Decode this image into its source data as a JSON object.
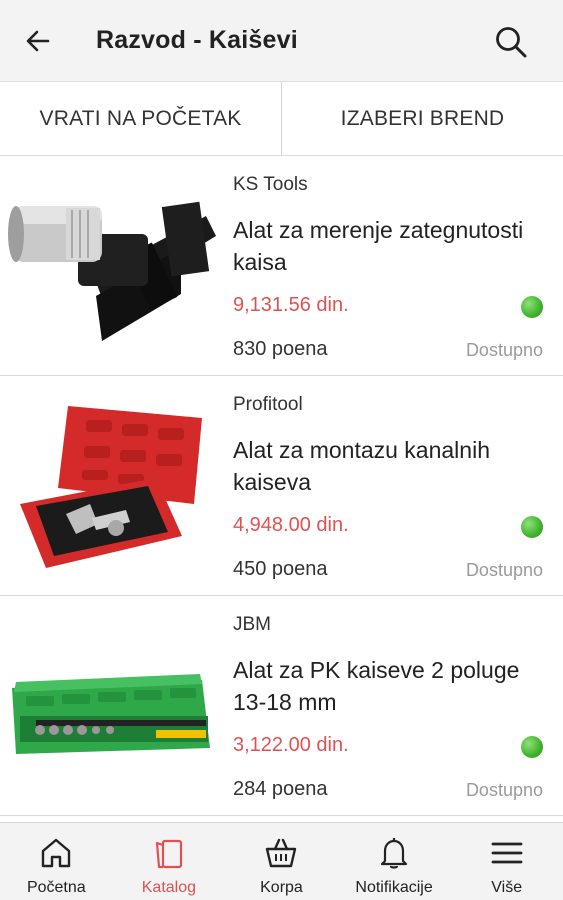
{
  "appbar": {
    "title": "Razvod - Kaiševi",
    "back_icon": "back-arrow-icon",
    "search_icon": "search-icon"
  },
  "actions": {
    "left_label": "VRATI NA POČETAK",
    "right_label": "IZABERI BREND"
  },
  "products": [
    {
      "brand": "KS Tools",
      "name": "Alat za merenje zategnutosti kaisa",
      "price": "9,131.56 din.",
      "points": "830 poena",
      "availability": "Dostupno"
    },
    {
      "brand": "Profitool",
      "name": "Alat za montazu kanalnih kaiseva",
      "price": "4,948.00 din.",
      "points": "450 poena",
      "availability": "Dostupno"
    },
    {
      "brand": "JBM",
      "name": "Alat za PK kaiseve 2 poluge 13-18 mm",
      "price": "3,122.00 din.",
      "points": "284 poena",
      "availability": "Dostupno"
    }
  ],
  "colors": {
    "accent": "#e05252",
    "available": "#3fb22c",
    "bar_bg": "#f3f3f3"
  },
  "bottom_nav": [
    {
      "label": "Početna",
      "icon": "home-icon",
      "active": false
    },
    {
      "label": "Katalog",
      "icon": "catalog-icon",
      "active": true
    },
    {
      "label": "Korpa",
      "icon": "basket-icon",
      "active": false
    },
    {
      "label": "Notifikacije",
      "icon": "bell-icon",
      "active": false
    },
    {
      "label": "Više",
      "icon": "menu-icon",
      "active": false
    }
  ]
}
